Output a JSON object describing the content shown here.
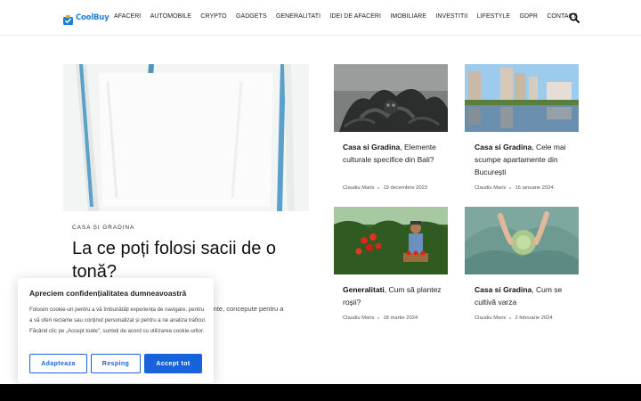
{
  "header": {
    "logo_text": "CoolBuy",
    "nav": [
      "AFACERI",
      "AUTOMOBILE",
      "CRYPTO",
      "GADGETS",
      "GENERALITATI",
      "IDEI DE AFACERI",
      "IMOBILIARE",
      "INVESTITII",
      "LIFESTYLE",
      "GDPR",
      "CONTACT"
    ],
    "search_icon": "search-icon"
  },
  "featured": {
    "category": "CASA ȘI GRADINA",
    "title": "La ce poți folosi sacii de o tonă?",
    "excerpt": "istente, concepute pentru a"
  },
  "cards": [
    {
      "category": "Casa si Gradina",
      "title": ", Elemente culturale specifice din Bali?",
      "author": "Claudiu Maris",
      "date": "19 decembrie 2023"
    },
    {
      "category": "Casa si Gradina",
      "title": ", Cele mai scumpe apartamente din București",
      "author": "Claudiu Maris",
      "date": "16 ianuarie 2024"
    },
    {
      "category": "Generalitati",
      "title": ", Cum să plantez roșii?",
      "author": "Claudiu Maris",
      "date": "18 martie 2024"
    },
    {
      "category": "Casa si Gradina",
      "title": ", Cum se cultivă varza",
      "author": "Claudiu Maris",
      "date": "2 februarie 2024"
    }
  ],
  "cookie": {
    "title": "Apreciem confidențialitatea dumneavoastră",
    "text": "Folosim cookie-uri pentru a vă îmbunătăți experiența de navigare, pentru a vă oferi reclame sau conținut personalizat și pentru a ne analiza traficul. Făcând clic pe „Accept toate\", sunteți de acord cu utilizarea cookie-urilor.",
    "customize_label": "Adapteaza",
    "reject_label": "Resping",
    "accept_label": "Accept tot"
  },
  "colors": {
    "brand": "#1f7fd6",
    "accent_button": "#1863dc",
    "footer": "#000000"
  }
}
